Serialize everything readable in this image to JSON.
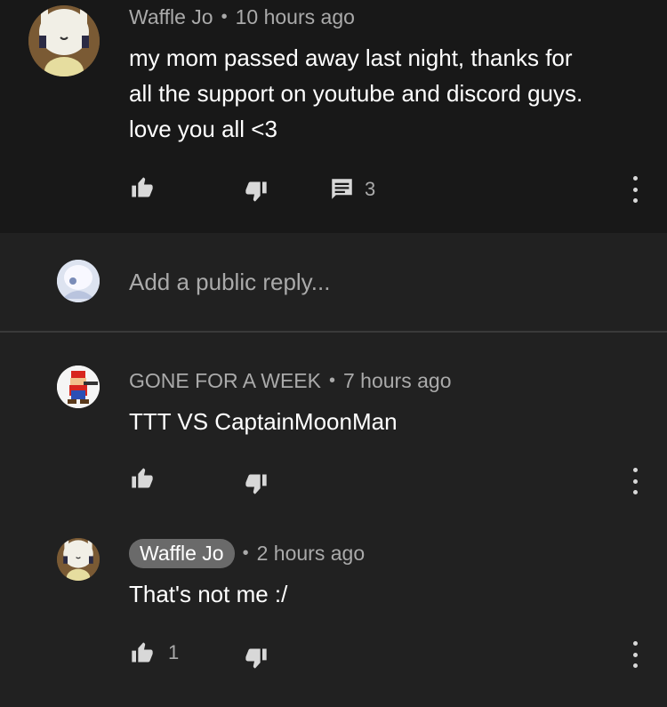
{
  "comments": [
    {
      "author": "Waffle Jo",
      "time": "10 hours ago",
      "text_lines": [
        "my mom passed away last night, thanks for",
        "all the support on youtube and discord guys.",
        "love you all <3"
      ],
      "likes": "",
      "replies": "3"
    },
    {
      "author": "GONE FOR A WEEK",
      "time": "7 hours ago",
      "text": "TTT VS CaptainMoonMan",
      "likes": ""
    },
    {
      "author": "Waffle Jo",
      "time": "2 hours ago",
      "text": "That's not me :/",
      "likes": "1"
    }
  ],
  "reply_box": {
    "placeholder": "Add a public reply..."
  },
  "separator": "•",
  "colors": {
    "background": "#212121",
    "highlight_background": "#181818",
    "secondary_text": "#aaaaaa",
    "author_chip": "#6a6a6a"
  },
  "icons": {
    "like": "thumbs-up-icon",
    "dislike": "thumbs-down-icon",
    "reply": "comment-icon",
    "menu": "more-vert-icon"
  }
}
